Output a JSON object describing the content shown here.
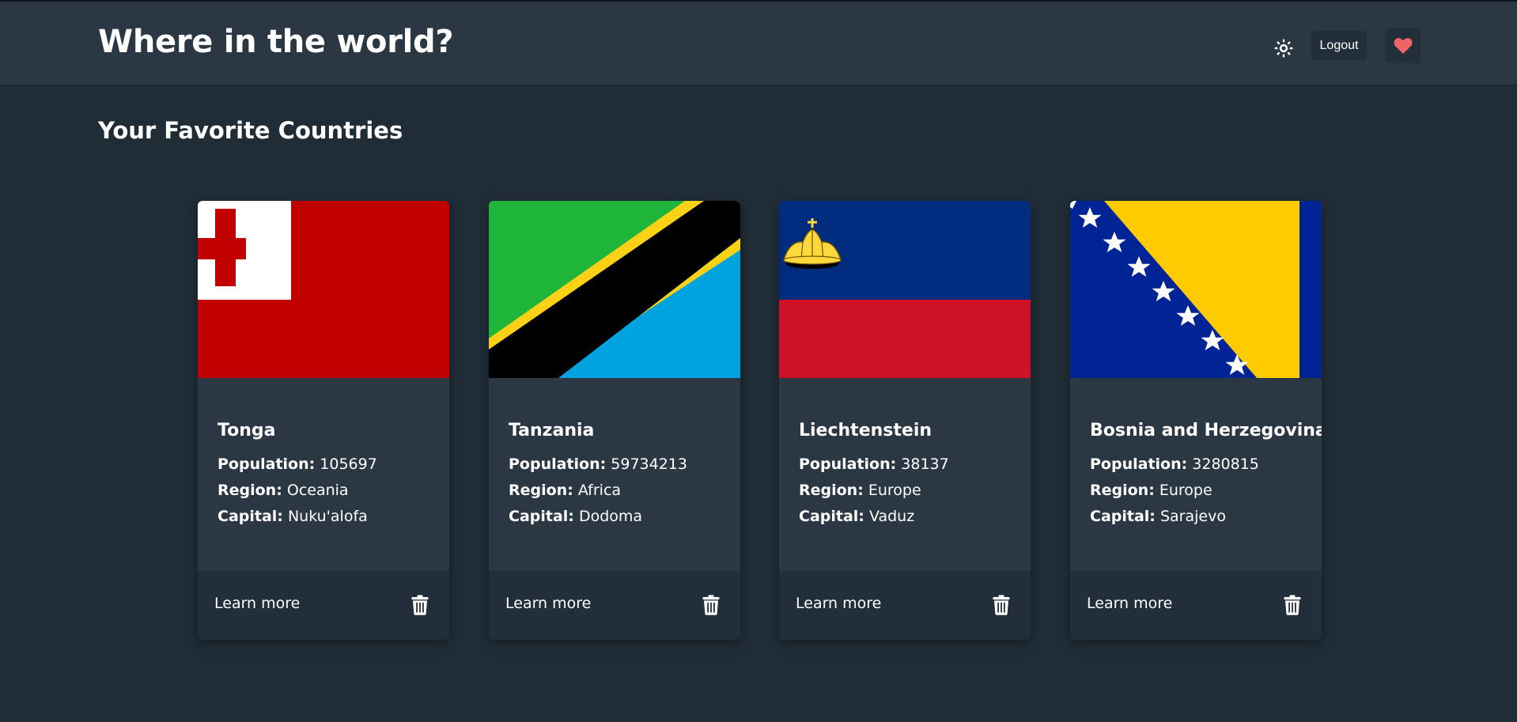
{
  "header": {
    "title": "Where in the world?",
    "theme_icon": "sun-icon",
    "logout_label": "Logout",
    "favorites_icon": "heart-icon",
    "accent_heart": "#f06464"
  },
  "main": {
    "section_title": "Your Favorite Countries",
    "labels": {
      "population": "Population:",
      "region": "Region:",
      "capital": "Capital:",
      "learn_more": "Learn more"
    },
    "countries": [
      {
        "name": "Tonga",
        "population": "105697",
        "region": "Oceania",
        "capital": "Nuku'alofa"
      },
      {
        "name": "Tanzania",
        "population": "59734213",
        "region": "Africa",
        "capital": "Dodoma"
      },
      {
        "name": "Liechtenstein",
        "population": "38137",
        "region": "Europe",
        "capital": "Vaduz"
      },
      {
        "name": "Bosnia and Herzegovina",
        "population": "3280815",
        "region": "Europe",
        "capital": "Sarajevo"
      }
    ]
  },
  "colors": {
    "background": "#202c36",
    "element": "#2b3844",
    "footer": "#222e39",
    "text": "#ffffff"
  }
}
